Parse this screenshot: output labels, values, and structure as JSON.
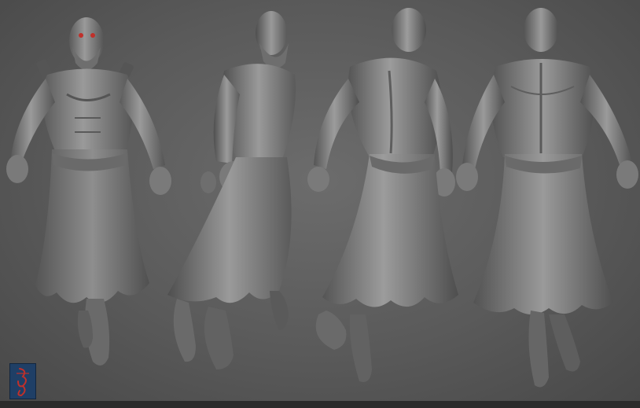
{
  "scene": {
    "subject": "sculpted-figure-turnaround",
    "views": [
      "front",
      "three-quarter-left",
      "three-quarter-back",
      "back"
    ]
  },
  "colors": {
    "background_center": "#6c6c6c",
    "background_edge": "#484848",
    "clay_light": "#9a9a9a",
    "clay_mid": "#7c7c7c",
    "clay_dark": "#4a4a4a",
    "eye_glow": "#c0302a",
    "badge_blue": "#1f3f66",
    "badge_mark": "#c0302a"
  },
  "signature": {
    "kind": "monogram-logo"
  }
}
